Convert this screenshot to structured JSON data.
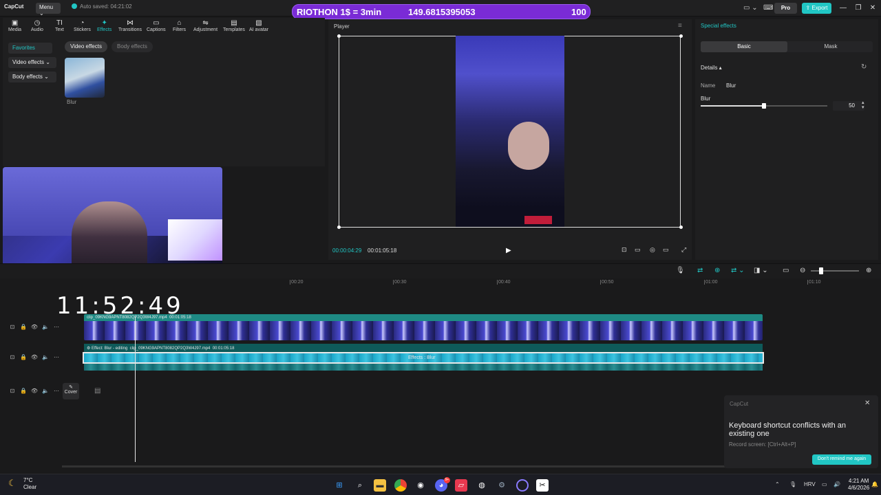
{
  "titlebar": {
    "app_name": "CapCut",
    "menu_label": "Menu",
    "autosave": "Auto saved: 04:21:02",
    "pro_label": "Pro",
    "export_label": "Export"
  },
  "banner": {
    "title": "RIOTHON 1$ = 3min",
    "value": "149.6815395053",
    "percent": "100"
  },
  "toolbar": {
    "items": [
      "Media",
      "Audio",
      "Text",
      "Stickers",
      "Effects",
      "Transitions",
      "Captions",
      "Filters",
      "Adjustment",
      "Templates",
      "AI avatar"
    ],
    "active": "Effects"
  },
  "left_panel": {
    "categories": [
      "Favorites",
      "Video effects",
      "Body effects"
    ],
    "pills": [
      "Video effects",
      "Body effects"
    ],
    "thumb_label": "Blur"
  },
  "player": {
    "title": "Player",
    "current_time": "00:00:04:29",
    "total_time": "00:01:05:18"
  },
  "right_panel": {
    "title": "Special effects",
    "tabs": [
      "Basic",
      "Mask"
    ],
    "details_label": "Details",
    "name_label": "Name",
    "name_value": "Blur",
    "blur_label": "Blur",
    "blur_value": "50",
    "blur_fraction": 0.5
  },
  "timeline": {
    "clock": "11:52:49",
    "ruler": [
      "00:20",
      "00:30",
      "00:40",
      "00:50",
      "01:00",
      "01:10"
    ],
    "clip1_name": "clip_09KNG9APNT8082QP2Q3W4J97.mp4",
    "clip1_duration": "00:01:05:18",
    "clip2_effect": "Effect: Blur - editing",
    "clip2_name": "clip_09KNG9APNT8082QP2Q3W4J97.mp4",
    "clip2_duration": "00:01:05:18",
    "effect_label": "Effects : Blur",
    "cover_label": "Cover"
  },
  "toast": {
    "app": "CapCut",
    "message": "Keyboard shortcut conflicts with an existing one",
    "sub": "Record screen: [Ctrl+Alt+P]",
    "button": "Don't remind me again"
  },
  "taskbar": {
    "temp": "7°C",
    "condition": "Clear",
    "lang": "HRV",
    "time": "4:21 AM",
    "date": "4/6/2026",
    "discord_badge": "9+"
  }
}
